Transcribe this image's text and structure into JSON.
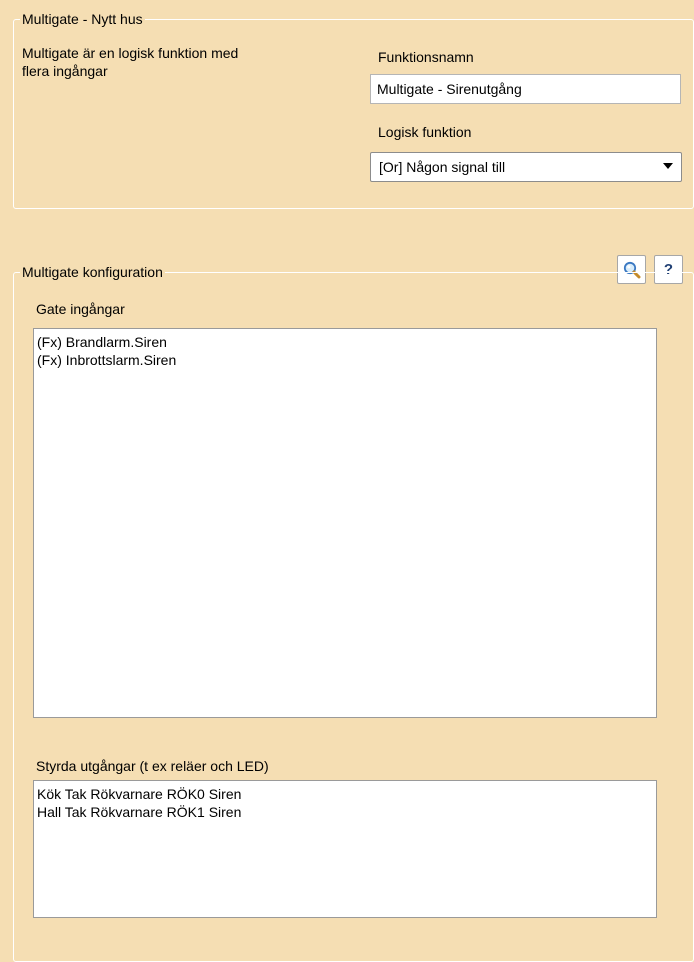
{
  "header_group": {
    "legend": "Multigate - Nytt hus",
    "description_line1": "Multigate är en logisk funktion med",
    "description_line2": "flera ingångar",
    "function_name_label": "Funktionsnamn",
    "function_name_value": "Multigate - Sirenutgång",
    "logic_function_label": "Logisk funktion",
    "logic_function_selected": "[Or] Någon signal till"
  },
  "toolbar": {
    "search_icon": "magnifier-icon",
    "help_label": "?"
  },
  "config_group": {
    "legend": "Multigate konfiguration",
    "inputs_label": "Gate ingångar",
    "inputs": [
      "(Fx) Brandlarm.Siren",
      "(Fx) Inbrottslarm.Siren"
    ],
    "outputs_label": "Styrda utgångar (t ex reläer och LED)",
    "outputs": [
      "Kök Tak Rökvarnare RÖK0 Siren",
      "Hall Tak Rökvarnare RÖK1 Siren"
    ]
  }
}
